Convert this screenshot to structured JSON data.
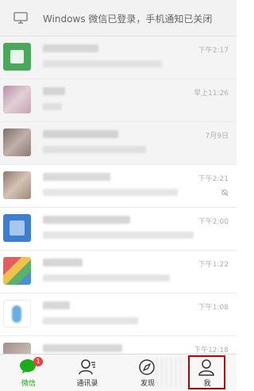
{
  "banner": {
    "icon": "desktop-icon",
    "text": "Windows 微信已登录，手机通知已关闭"
  },
  "chats": [
    {
      "time": "下午2:17",
      "avatar_color": "#4aa85a",
      "muted": false
    },
    {
      "time": "早上11:26",
      "avatar_color": "#c9a3b9",
      "muted": false
    },
    {
      "time": "7月9日",
      "avatar_color": "#9a8a86",
      "muted": false
    },
    {
      "time": "下午2:21",
      "avatar_color": "#b39a86",
      "muted": true
    },
    {
      "time": "下午2:00",
      "avatar_color": "#3d7ecf",
      "muted": false
    },
    {
      "time": "下午1:22",
      "avatar_color": "#7fb2d8",
      "muted": false
    },
    {
      "time": "下午1:08",
      "avatar_color": "#6aaee0",
      "muted": false
    },
    {
      "time": "下午12:18",
      "avatar_color": "#b9a6a0",
      "muted": false
    }
  ],
  "tabs": {
    "chats": {
      "label": "微信",
      "badge": "1",
      "icon": "chat-bubble-icon"
    },
    "contacts": {
      "label": "通讯录",
      "icon": "contacts-icon"
    },
    "discover": {
      "label": "发现",
      "icon": "compass-icon"
    },
    "me": {
      "label": "我",
      "icon": "person-icon"
    }
  },
  "colors": {
    "accent_green": "#1aad19",
    "highlight_red": "#b00000",
    "badge_red": "#e64340"
  }
}
